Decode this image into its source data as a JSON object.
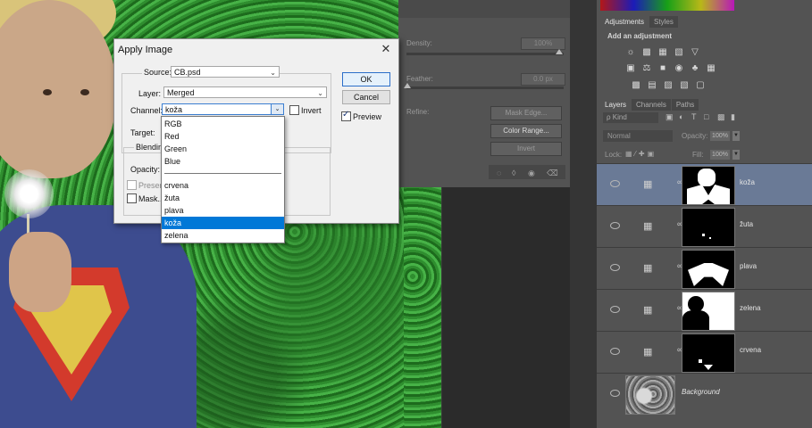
{
  "properties_panel": {
    "density_label": "Density:",
    "density_value": "100%",
    "feather_label": "Feather:",
    "feather_value": "0.0 px",
    "refine_label": "Refine:",
    "mask_edge_button": "Mask Edge...",
    "color_range_button": "Color Range...",
    "invert_button": "Invert"
  },
  "adjustments_panel": {
    "tabs": [
      "Adjustments",
      "Styles"
    ],
    "title": "Add an adjustment"
  },
  "layers_panel": {
    "tabs": [
      "Layers",
      "Channels",
      "Paths"
    ],
    "kind_filter": "ρ Kind",
    "blend_mode": "Normal",
    "opacity_label": "Opacity:",
    "opacity_value": "100%",
    "lock_label": "Lock:",
    "fill_label": "Fill:",
    "fill_value": "100%",
    "layers": [
      {
        "name": "koža",
        "selected": true
      },
      {
        "name": "žuta",
        "selected": false
      },
      {
        "name": "plava",
        "selected": false
      },
      {
        "name": "zelena",
        "selected": false
      },
      {
        "name": "crvena",
        "selected": false
      }
    ],
    "background_layer": "Background"
  },
  "dialog": {
    "title": "Apply Image",
    "source_label": "Source:",
    "source_value": "CB.psd",
    "layer_label": "Layer:",
    "layer_value": "Merged",
    "channel_label": "Channel:",
    "channel_value": "koža",
    "invert_label": "Invert",
    "target_label": "Target:",
    "blending_label": "Blendin",
    "opacity_label": "Opacity:",
    "preserve_label": "Presen",
    "mask_label": "Mask...",
    "ok_button": "OK",
    "cancel_button": "Cancel",
    "preview_label": "Preview",
    "channel_options": [
      "RGB",
      "Red",
      "Green",
      "Blue",
      "crvena",
      "žuta",
      "plava",
      "koža",
      "zelena"
    ],
    "selected_channel": "koža"
  }
}
